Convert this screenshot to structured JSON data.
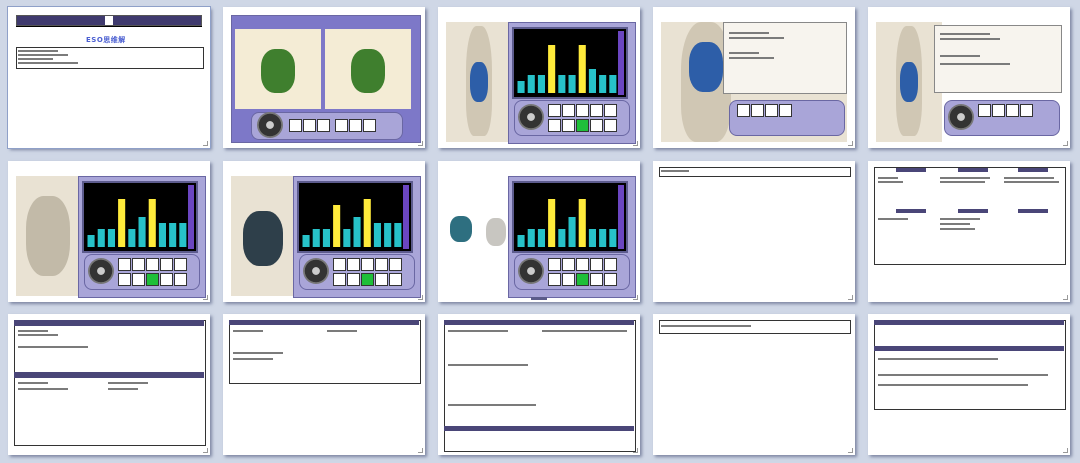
{
  "slides": [
    {
      "id": 1,
      "kind": "title",
      "title": "ESO思维解"
    },
    {
      "id": 2,
      "kind": "heart-views"
    },
    {
      "id": 3,
      "kind": "body-chart",
      "chart_data": {
        "type": "bar",
        "values": [
          2,
          3,
          3,
          8,
          3,
          3,
          8,
          4,
          3,
          3
        ],
        "ylim": [
          0,
          10
        ]
      }
    },
    {
      "id": 4,
      "kind": "body-dialog"
    },
    {
      "id": 5,
      "kind": "body-dialog"
    },
    {
      "id": 6,
      "kind": "bone-chart",
      "chart_data": {
        "type": "bar",
        "values": [
          2,
          3,
          3,
          8,
          3,
          5,
          8,
          4,
          4,
          4
        ],
        "ylim": [
          0,
          10
        ]
      }
    },
    {
      "id": 7,
      "kind": "heart-chart",
      "chart_data": {
        "type": "bar",
        "values": [
          2,
          3,
          3,
          7,
          3,
          5,
          8,
          4,
          4,
          4
        ],
        "ylim": [
          0,
          10
        ]
      }
    },
    {
      "id": 8,
      "kind": "organ-chart",
      "chart_data": {
        "type": "bar",
        "values": [
          2,
          3,
          3,
          8,
          3,
          5,
          8,
          3,
          3,
          3
        ],
        "ylim": [
          0,
          10
        ]
      }
    },
    {
      "id": 9,
      "kind": "blank-header"
    },
    {
      "id": 10,
      "kind": "table"
    },
    {
      "id": 11,
      "kind": "table"
    },
    {
      "id": 12,
      "kind": "table"
    },
    {
      "id": 13,
      "kind": "table"
    },
    {
      "id": 14,
      "kind": "blank-header"
    },
    {
      "id": 15,
      "kind": "table"
    }
  ]
}
